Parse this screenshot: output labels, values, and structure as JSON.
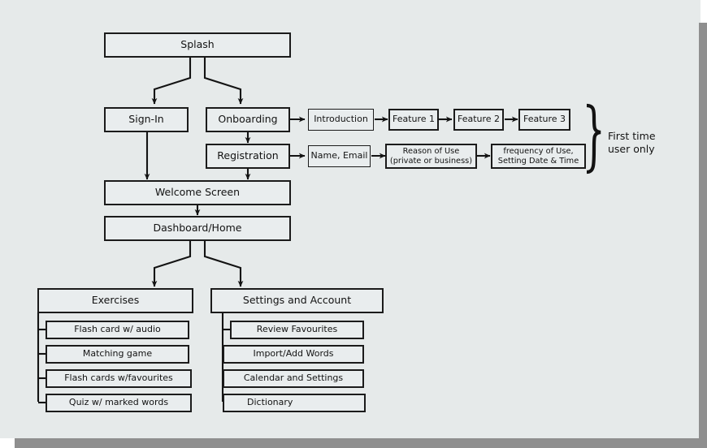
{
  "diagram": {
    "title": "App navigation flowchart",
    "background_color": "#e6eaea",
    "node_fill": "#e9edee",
    "node_border": "#1b1b1b",
    "scrollbar_color": "#8f8f8f",
    "nodes": {
      "splash": "Splash",
      "sign_in": "Sign-In",
      "onboarding": "Onboarding",
      "registration": "Registration",
      "welcome_screen": "Welcome Screen",
      "dashboard_home": "Dashboard/Home",
      "introduction": "Introduction",
      "feature_1": "Feature 1",
      "feature_2": "Feature 2",
      "feature_3": "Feature 3",
      "name_email": "Name, Email",
      "reason_of_use": "Reason of Use\n(private or business)",
      "frequency_of_use": "frequency of Use,\nSetting Date & Time",
      "exercises": "Exercises",
      "settings_and_account": "Settings and Account"
    },
    "exercises_children": [
      "Flash card w/ audio",
      "Matching game",
      "Flash cards w/favourites",
      "Quiz w/ marked words"
    ],
    "settings_children": [
      "Review Favourites",
      "Import/Add Words",
      "Calendar and Settings",
      "Dictionary"
    ],
    "annotation": {
      "brace_label": "First time\nuser only"
    }
  }
}
